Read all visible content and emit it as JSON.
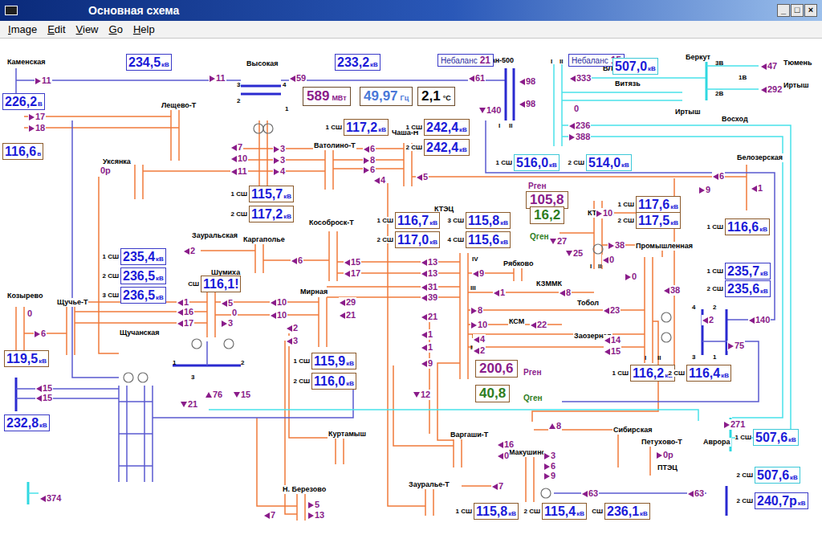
{
  "window": {
    "title": "Основная схема",
    "controls": [
      "_",
      "□",
      "×"
    ]
  },
  "menu": [
    "Image",
    "Edit",
    "View",
    "Go",
    "Help"
  ],
  "stations": [
    "Каменская",
    "Высокая",
    "Лещево-Т",
    "Уксянка",
    "Ватолино-Т",
    "Чаша-Н",
    "Курган-500",
    "ВЛ",
    "Беркут",
    "Витязь",
    "Иртыш",
    "Восход",
    "Тюмень",
    "Иртыш",
    "Белозерская",
    "КТЭЦ",
    "КТЭЦ-2",
    "Кособроск-Т",
    "Каргаполье",
    "Зауральская",
    "Шумиха",
    "Рябково",
    "КЗММК",
    "Тобол",
    "Промышленная",
    "КСМ",
    "Заозерная",
    "Мирная",
    "Козырево",
    "Щучье-Т",
    "Щучанская",
    "Куртамыш",
    "Н. Березово",
    "Варгаши-Т",
    "Макушино",
    "Сибирская",
    "Петухово-Т",
    "ПТЭЦ",
    "Зауралье-Т",
    "Аврора"
  ],
  "indicators": [
    {
      "value": "589",
      "unit": "МВт",
      "color": "#8a1c8a"
    },
    {
      "value": "49,97",
      "unit": "Гц",
      "color": "#4a78d8"
    },
    {
      "value": "2,1",
      "unit": "°С",
      "color": "#000000"
    }
  ],
  "imbalances": [
    {
      "label": "Небаланс",
      "value": "21"
    },
    {
      "label": "Небаланс",
      "value": "15"
    }
  ],
  "readings": [
    {
      "label": "",
      "value": "234,5",
      "unit": "кВ",
      "color": "#3a3ac8"
    },
    {
      "label": "",
      "value": "233,2",
      "unit": "кВ",
      "color": "#3a3ac8"
    },
    {
      "label": "",
      "value": "226,2",
      "unit": "В",
      "color": "#3a3ac8"
    },
    {
      "label": "",
      "value": "116,6",
      "unit": "в",
      "color": "#8b5a2b"
    },
    {
      "label": "1 СШ",
      "value": "117,2",
      "unit": "кВ",
      "color": "#8b5a2b"
    },
    {
      "label": "1 СШ",
      "value": "242,4",
      "unit": "кВ",
      "color": "#8b5a2b"
    },
    {
      "label": "2 СШ",
      "value": "242,4",
      "unit": "кВ",
      "color": "#8b5a2b"
    },
    {
      "label": "",
      "value": "507,0",
      "unit": "кВ",
      "color": "#3cc8d8"
    },
    {
      "label": "1 СШ",
      "value": "516,0",
      "unit": "кВ",
      "color": "#3cc8d8"
    },
    {
      "label": "2 СШ",
      "value": "514,0",
      "unit": "кВ",
      "color": "#3cc8d8"
    },
    {
      "label": "1 СШ",
      "value": "115,7",
      "unit": "кВ",
      "color": "#8b5a2b"
    },
    {
      "label": "2 СШ",
      "value": "117,2",
      "unit": "кВ",
      "color": "#8b5a2b"
    },
    {
      "label": "1 СШ",
      "value": "116,7",
      "unit": "кВ",
      "color": "#8b5a2b"
    },
    {
      "label": "2 СШ",
      "value": "117,0",
      "unit": "кВ",
      "color": "#8b5a2b"
    },
    {
      "label": "3 СШ",
      "value": "115,8",
      "unit": "кВ",
      "color": "#8b5a2b"
    },
    {
      "label": "4 СШ",
      "value": "115,6",
      "unit": "кВ",
      "color": "#8b5a2b"
    },
    {
      "label": "1 СШ",
      "value": "117,6",
      "unit": "кВ",
      "color": "#8b5a2b"
    },
    {
      "label": "2 СШ",
      "value": "117,5",
      "unit": "кВ",
      "color": "#8b5a2b"
    },
    {
      "label": "1 СШ",
      "value": "116,6",
      "unit": "кВ",
      "color": "#8b5a2b"
    },
    {
      "label": "1 СШ",
      "value": "235,4",
      "unit": "кВ",
      "color": "#3a3ac8"
    },
    {
      "label": "2 СШ",
      "value": "236,5",
      "unit": "кВ",
      "color": "#3a3ac8"
    },
    {
      "label": "3 СШ",
      "value": "236,5",
      "unit": "кВ",
      "color": "#3a3ac8"
    },
    {
      "label": "СШ",
      "value": "116,1!",
      "unit": "",
      "color": "#8b5a2b"
    },
    {
      "label": "1 СШ",
      "value": "235,7",
      "unit": "кВ",
      "color": "#3a3ac8"
    },
    {
      "label": "2 СШ",
      "value": "235,6",
      "unit": "кВ",
      "color": "#3a3ac8"
    },
    {
      "label": "",
      "value": "119,5",
      "unit": "кВ",
      "color": "#8b5a2b"
    },
    {
      "label": "1 СШ",
      "value": "115,9",
      "unit": "кВ",
      "color": "#8b5a2b"
    },
    {
      "label": "2 СШ",
      "value": "116,0",
      "unit": "кВ",
      "color": "#8b5a2b"
    },
    {
      "label": "1 СШ",
      "value": "116,2",
      "unit": "кВ",
      "color": "#8b5a2b"
    },
    {
      "label": "2 СШ",
      "value": "116,4",
      "unit": "кВ",
      "color": "#8b5a2b"
    },
    {
      "label": "",
      "value": "232,8",
      "unit": "кВ",
      "color": "#3a3ac8"
    },
    {
      "label": "1 СШ",
      "value": "507,6",
      "unit": "кВ",
      "color": "#3cc8d8"
    },
    {
      "label": "2 СШ",
      "value": "507,6",
      "unit": "кВ",
      "color": "#3cc8d8"
    },
    {
      "label": "2 СШ",
      "value": "240,7р",
      "unit": "кВ",
      "color": "#3a3ac8"
    },
    {
      "label": "1 СШ",
      "value": "115,8",
      "unit": "кВ",
      "color": "#8b5a2b"
    },
    {
      "label": "2 СШ",
      "value": "115,4",
      "unit": "кВ",
      "color": "#8b5a2b"
    },
    {
      "label": "СШ",
      "value": "236,1",
      "unit": "кВ",
      "color": "#8b5a2b"
    }
  ],
  "gen_values": [
    {
      "label": "Рген",
      "value": "105,8",
      "color": "#8a1c8a"
    },
    {
      "label": "Qген",
      "value": "16,2",
      "color": "#2e7d1e"
    },
    {
      "label": "Рген",
      "value": "200,6",
      "color": "#8a1c8a"
    },
    {
      "label": "Qген",
      "value": "40,8",
      "color": "#2e7d1e"
    }
  ],
  "flows": [
    {
      "value": "11",
      "dir": "right"
    },
    {
      "value": "11",
      "dir": "right"
    },
    {
      "value": "59",
      "dir": "left"
    },
    {
      "value": "61",
      "dir": "left"
    },
    {
      "value": "98",
      "dir": "left"
    },
    {
      "value": "98",
      "dir": "left"
    },
    {
      "value": "140",
      "dir": "down"
    },
    {
      "value": "333",
      "dir": "left"
    },
    {
      "value": "0",
      "dir": "none"
    },
    {
      "value": "236",
      "dir": "left"
    },
    {
      "value": "388",
      "dir": "right"
    },
    {
      "value": "47",
      "dir": "left"
    },
    {
      "value": "292",
      "dir": "left"
    },
    {
      "value": "17",
      "dir": "right"
    },
    {
      "value": "18",
      "dir": "right"
    },
    {
      "value": "0р",
      "dir": "none"
    },
    {
      "value": "7",
      "dir": "left"
    },
    {
      "value": "10",
      "dir": "left"
    },
    {
      "value": "11",
      "dir": "left"
    },
    {
      "value": "3",
      "dir": "right"
    },
    {
      "value": "3",
      "dir": "right"
    },
    {
      "value": "4",
      "dir": "right"
    },
    {
      "value": "6",
      "dir": "left"
    },
    {
      "value": "8",
      "dir": "right"
    },
    {
      "value": "6",
      "dir": "right"
    },
    {
      "value": "4",
      "dir": "left"
    },
    {
      "value": "5",
      "dir": "left"
    },
    {
      "value": "6",
      "dir": "left"
    },
    {
      "value": "9",
      "dir": "right"
    },
    {
      "value": "1",
      "dir": "left"
    },
    {
      "value": "10",
      "dir": "right"
    },
    {
      "value": "27",
      "dir": "down"
    },
    {
      "value": "25",
      "dir": "down"
    },
    {
      "value": "38",
      "dir": "right"
    },
    {
      "value": "0",
      "dir": "left"
    },
    {
      "value": "0",
      "dir": "right"
    },
    {
      "value": "38",
      "dir": "left"
    },
    {
      "value": "2",
      "dir": "left"
    },
    {
      "value": "6",
      "dir": "left"
    },
    {
      "value": "15",
      "dir": "left"
    },
    {
      "value": "17",
      "dir": "left"
    },
    {
      "value": "13",
      "dir": "left"
    },
    {
      "value": "13",
      "dir": "left"
    },
    {
      "value": "31",
      "dir": "left"
    },
    {
      "value": "39",
      "dir": "left"
    },
    {
      "value": "9",
      "dir": "left"
    },
    {
      "value": "1",
      "dir": "left"
    },
    {
      "value": "8",
      "dir": "left"
    },
    {
      "value": "1",
      "dir": "left"
    },
    {
      "value": "16",
      "dir": "left"
    },
    {
      "value": "17",
      "dir": "left"
    },
    {
      "value": "5",
      "dir": "left"
    },
    {
      "value": "0",
      "dir": "none"
    },
    {
      "value": "3",
      "dir": "right"
    },
    {
      "value": "10",
      "dir": "left"
    },
    {
      "value": "10",
      "dir": "left"
    },
    {
      "value": "29",
      "dir": "left"
    },
    {
      "value": "21",
      "dir": "left"
    },
    {
      "value": "0",
      "dir": "none"
    },
    {
      "value": "6",
      "dir": "right"
    },
    {
      "value": "2",
      "dir": "left"
    },
    {
      "value": "3",
      "dir": "left"
    },
    {
      "value": "21",
      "dir": "left"
    },
    {
      "value": "8",
      "dir": "right"
    },
    {
      "value": "10",
      "dir": "right"
    },
    {
      "value": "22",
      "dir": "left"
    },
    {
      "value": "23",
      "dir": "left"
    },
    {
      "value": "1",
      "dir": "left"
    },
    {
      "value": "1",
      "dir": "left"
    },
    {
      "value": "4",
      "dir": "left"
    },
    {
      "value": "2",
      "dir": "left"
    },
    {
      "value": "14",
      "dir": "left"
    },
    {
      "value": "15",
      "dir": "left"
    },
    {
      "value": "140",
      "dir": "left"
    },
    {
      "value": "2",
      "dir": "left"
    },
    {
      "value": "75",
      "dir": "right"
    },
    {
      "value": "9",
      "dir": "left"
    },
    {
      "value": "12",
      "dir": "down"
    },
    {
      "value": "21",
      "dir": "down"
    },
    {
      "value": "76",
      "dir": "up"
    },
    {
      "value": "15",
      "dir": "down"
    },
    {
      "value": "15",
      "dir": "left"
    },
    {
      "value": "15",
      "dir": "left"
    },
    {
      "value": "8",
      "dir": "up"
    },
    {
      "value": "271",
      "dir": "right"
    },
    {
      "value": "16",
      "dir": "left"
    },
    {
      "value": "0",
      "dir": "left"
    },
    {
      "value": "3",
      "dir": "right"
    },
    {
      "value": "6",
      "dir": "right"
    },
    {
      "value": "9",
      "dir": "right"
    },
    {
      "value": "0р",
      "dir": "right"
    },
    {
      "value": "7",
      "dir": "left"
    },
    {
      "value": "63",
      "dir": "left"
    },
    {
      "value": "63",
      "dir": "left"
    },
    {
      "value": "374",
      "dir": "left"
    },
    {
      "value": "5",
      "dir": "right"
    },
    {
      "value": "13",
      "dir": "right"
    },
    {
      "value": "7",
      "dir": "left"
    }
  ],
  "bus_marks": [
    "3",
    "4",
    "2",
    "1",
    "1",
    "2",
    "3",
    "4",
    "2",
    "3",
    "1",
    "I",
    "II",
    "IV",
    "III",
    "I",
    "II",
    "I",
    "II",
    "I",
    "II",
    "I",
    "II",
    "3В",
    "1В",
    "2В"
  ]
}
